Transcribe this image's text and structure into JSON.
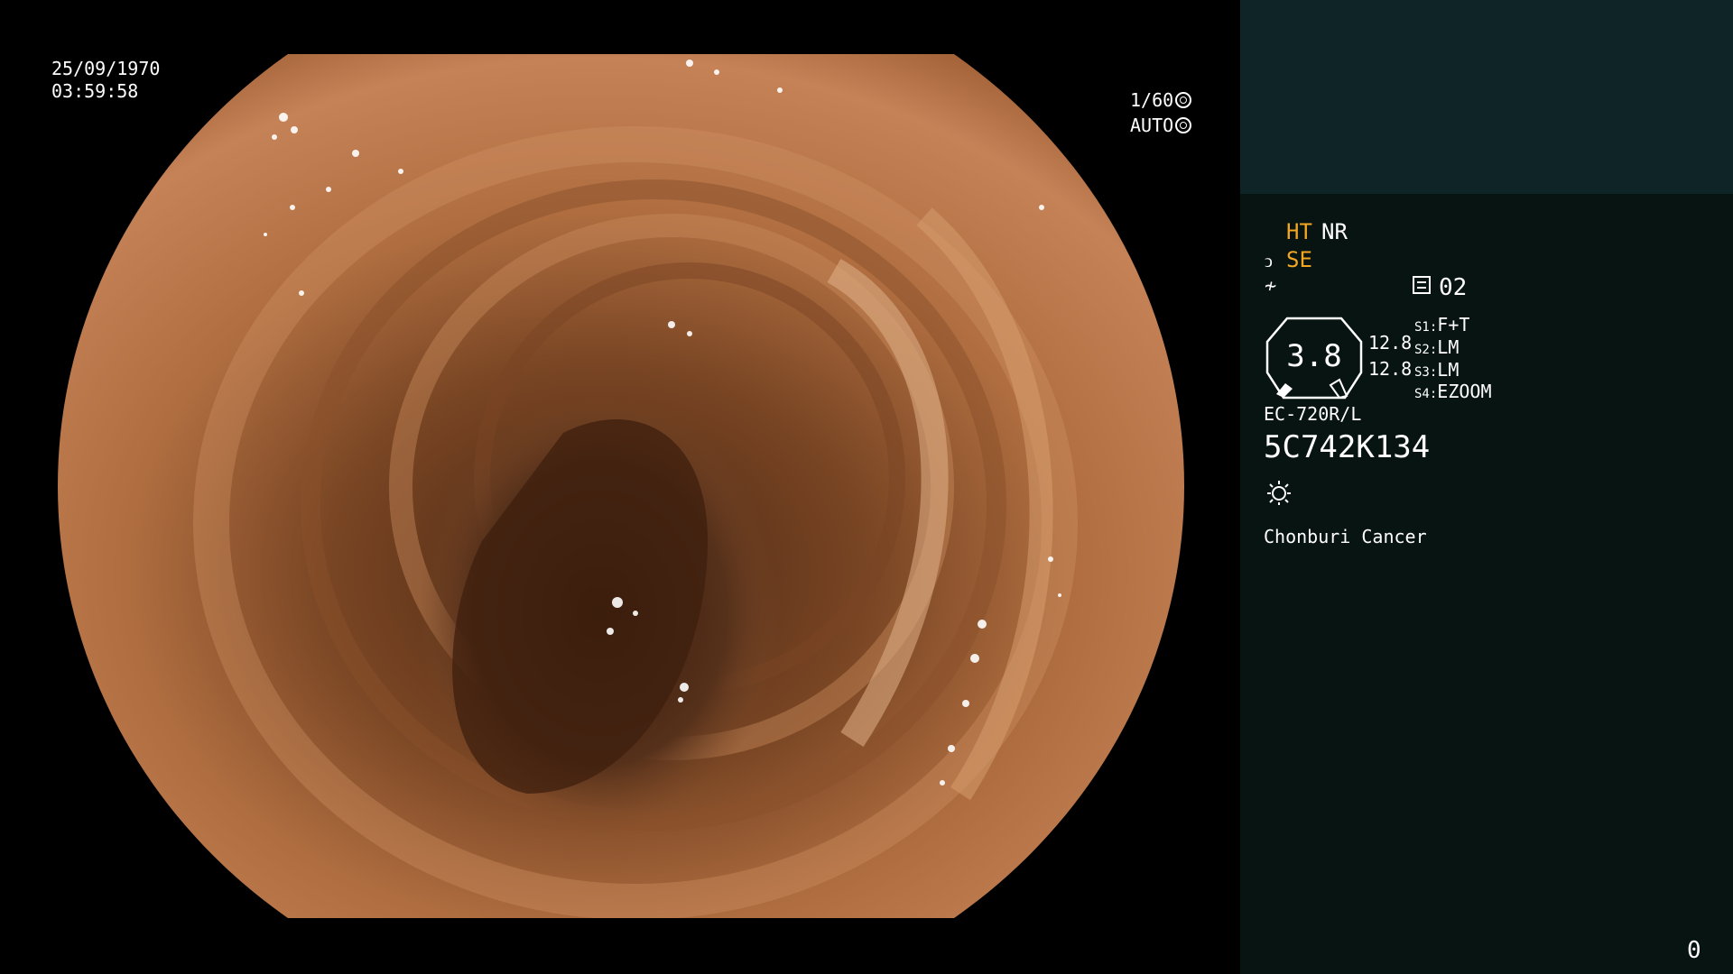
{
  "overlay": {
    "date": "25/09/1970",
    "time": "03:59:58",
    "shutter": "1/60",
    "iris": "AUTO"
  },
  "panel": {
    "enhancement": "HT",
    "noise_reduction": "NR",
    "structure_enhancement": "SE",
    "memory_slot": "02",
    "zoom": "3.8",
    "value_a": "12.8",
    "value_b": "12.8",
    "switches": [
      {
        "key": "S1:",
        "value": "F+T"
      },
      {
        "key": "S2:",
        "value": "LM"
      },
      {
        "key": "S3:",
        "value": "LM"
      },
      {
        "key": "S4:",
        "value": "EZOOM"
      }
    ],
    "scope_model": "EC-720R/L",
    "serial_number": "5C742K134",
    "hospital_name": "Chonburi Cancer",
    "counter": "0"
  },
  "colors": {
    "accent": "#f2a623",
    "panel_top": "#0e2426",
    "panel_bottom": "#071412",
    "background": "#000000"
  },
  "icons": [
    "shutter-icon",
    "iris-icon",
    "se-icon",
    "edge-icon",
    "memory-icon",
    "light-icon"
  ]
}
